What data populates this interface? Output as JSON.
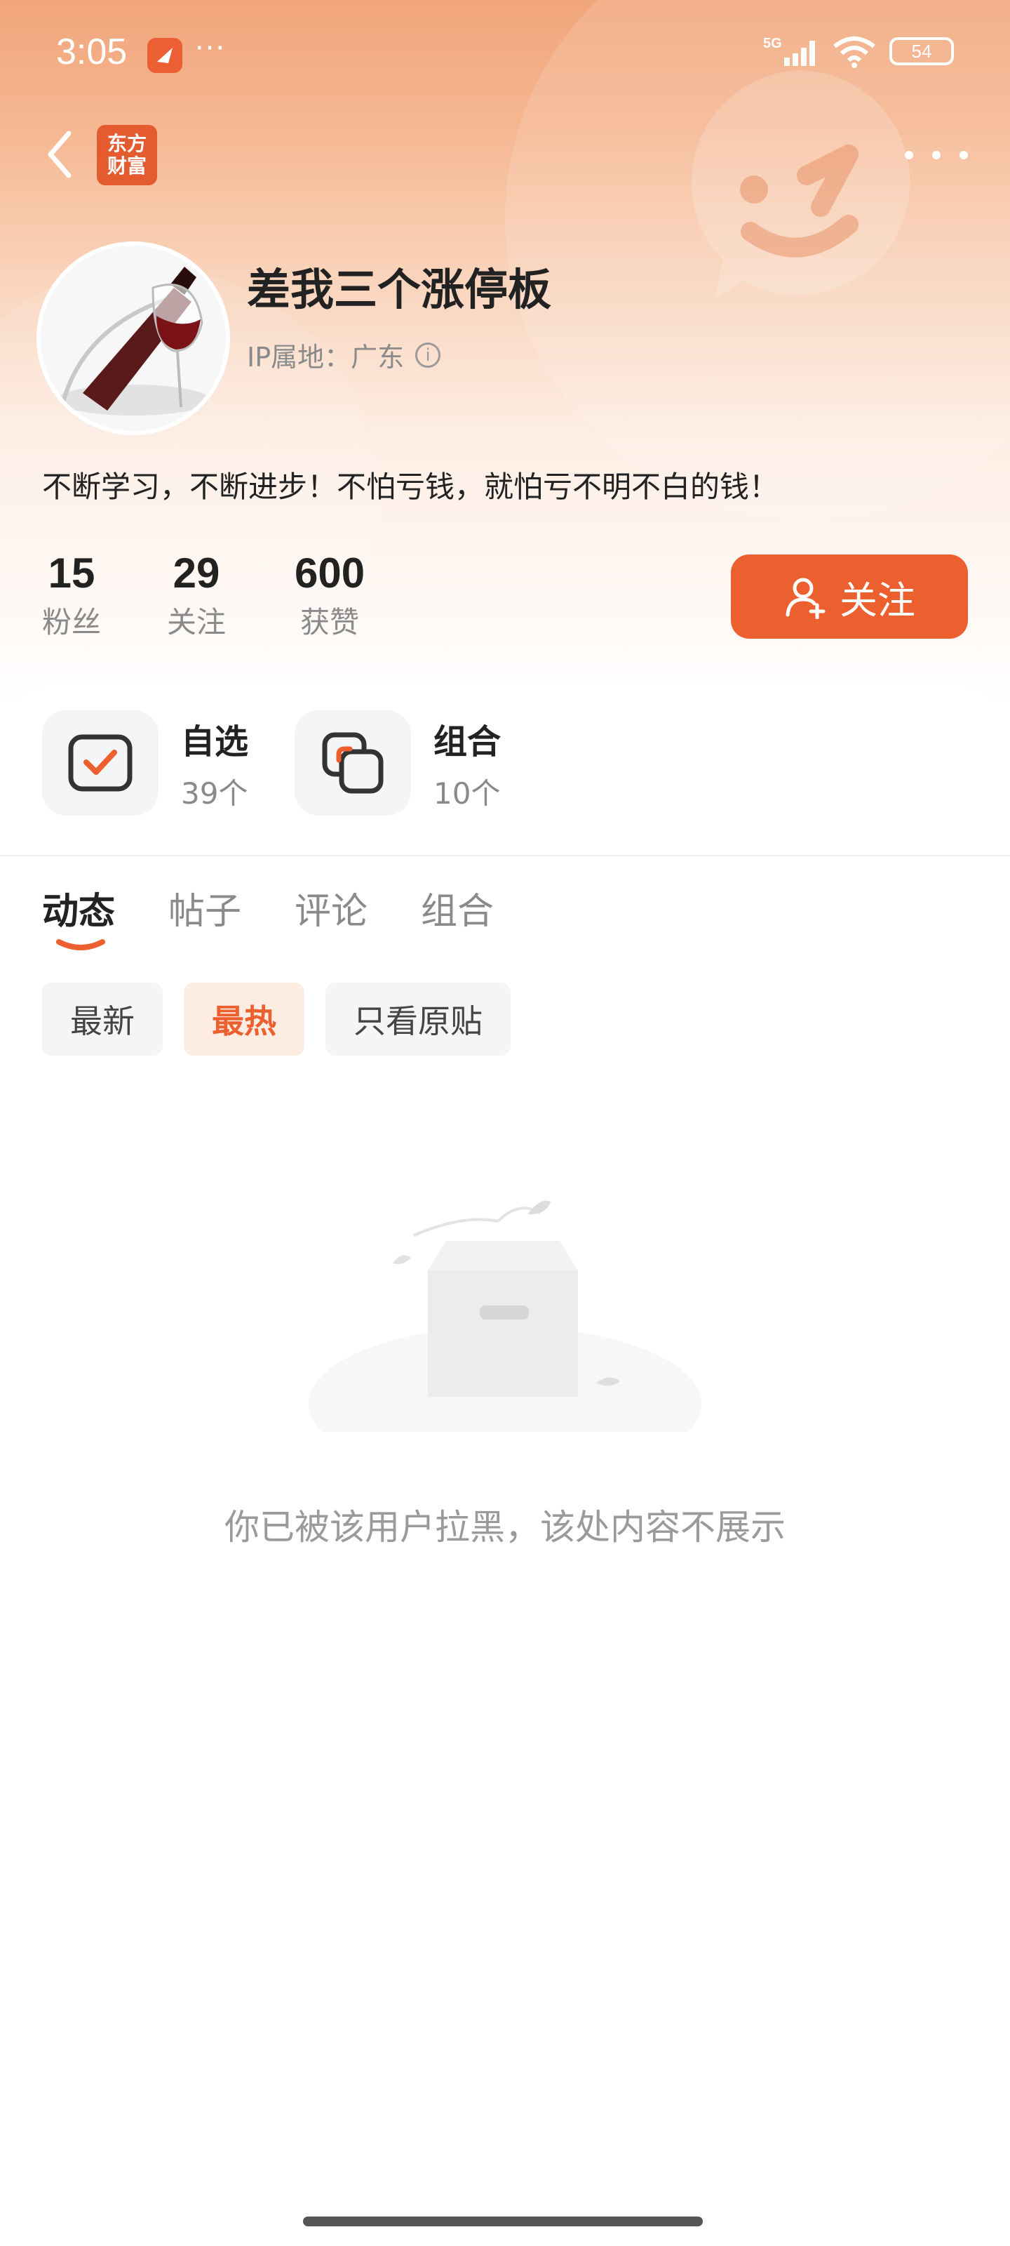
{
  "status_bar": {
    "time": "3:05",
    "dots": "···",
    "network": "5G",
    "battery": "54"
  },
  "nav": {
    "logo_line1": "东方",
    "logo_line2": "财富"
  },
  "profile": {
    "username": "差我三个涨停板",
    "ip_location": "IP属地：广东",
    "bio": "不断学习，不断进步！不怕亏钱，就怕亏不明不白的钱！",
    "stats": [
      {
        "value": "15",
        "label": "粉丝"
      },
      {
        "value": "29",
        "label": "关注"
      },
      {
        "value": "600",
        "label": "获赞"
      }
    ],
    "follow_label": "关注"
  },
  "shortcuts": [
    {
      "title": "自选",
      "count": "39个",
      "icon": "checklist-icon"
    },
    {
      "title": "组合",
      "count": "10个",
      "icon": "portfolio-icon"
    }
  ],
  "tabs": [
    "动态",
    "帖子",
    "评论",
    "组合"
  ],
  "filters": [
    "最新",
    "最热",
    "只看原贴"
  ],
  "empty_state": {
    "message": "你已被该用户拉黑，该处内容不展示"
  },
  "colors": {
    "accent": "#ec5f2e",
    "header_top": "#f1a57b"
  }
}
